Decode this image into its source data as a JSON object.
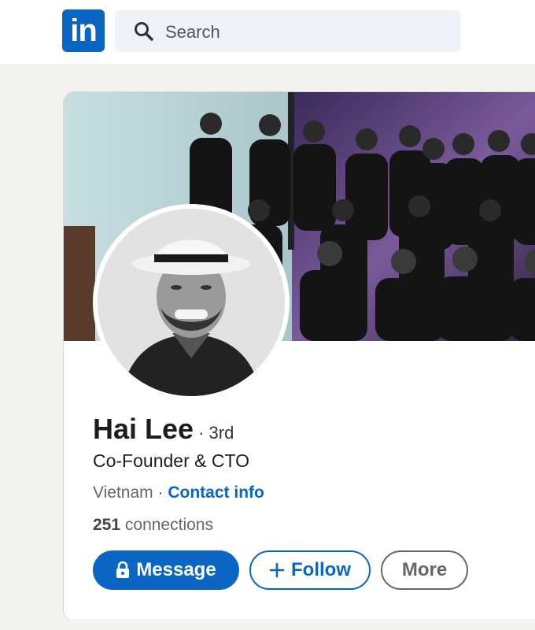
{
  "header": {
    "logo_text": "in",
    "search": {
      "placeholder": "Search",
      "icon": "search-icon"
    }
  },
  "profile": {
    "name": "Hai Lee",
    "degree": "· 3rd",
    "headline": "Co-Founder & CTO",
    "location": "Vietnam",
    "separator": "·",
    "contact_info_label": "Contact info",
    "connections_count": "251",
    "connections_label": "connections"
  },
  "actions": {
    "message_label": "Message",
    "message_icon": "lock-icon",
    "follow_label": "Follow",
    "follow_icon": "plus-icon",
    "more_label": "More"
  },
  "colors": {
    "brand": "#0a66c2",
    "page_bg": "#f4f2ee"
  }
}
